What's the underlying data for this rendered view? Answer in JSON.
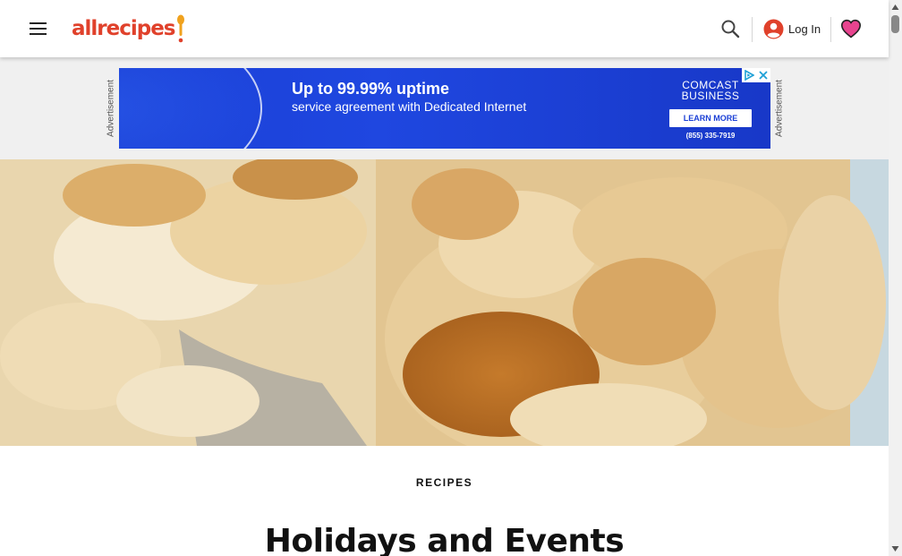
{
  "header": {
    "logo_text": "allrecipes",
    "login_label": "Log In"
  },
  "ad": {
    "label": "Advertisement",
    "headline": "Up to 99.99% uptime",
    "subline": "service agreement with Dedicated Internet",
    "brand_line1": "COMCAST",
    "brand_line2": "BUSINESS",
    "cta": "LEARN MORE",
    "phone": "(855) 335-7919"
  },
  "page": {
    "eyebrow": "RECIPES",
    "title": "Holidays and Events"
  },
  "colors": {
    "brand": "#e0412b",
    "ad_blue": "#1a3fd6",
    "heart": "#e8448f"
  },
  "icons": [
    "menu-icon",
    "search-icon",
    "user-icon",
    "heart-icon",
    "ad-choices-icon",
    "close-icon"
  ]
}
